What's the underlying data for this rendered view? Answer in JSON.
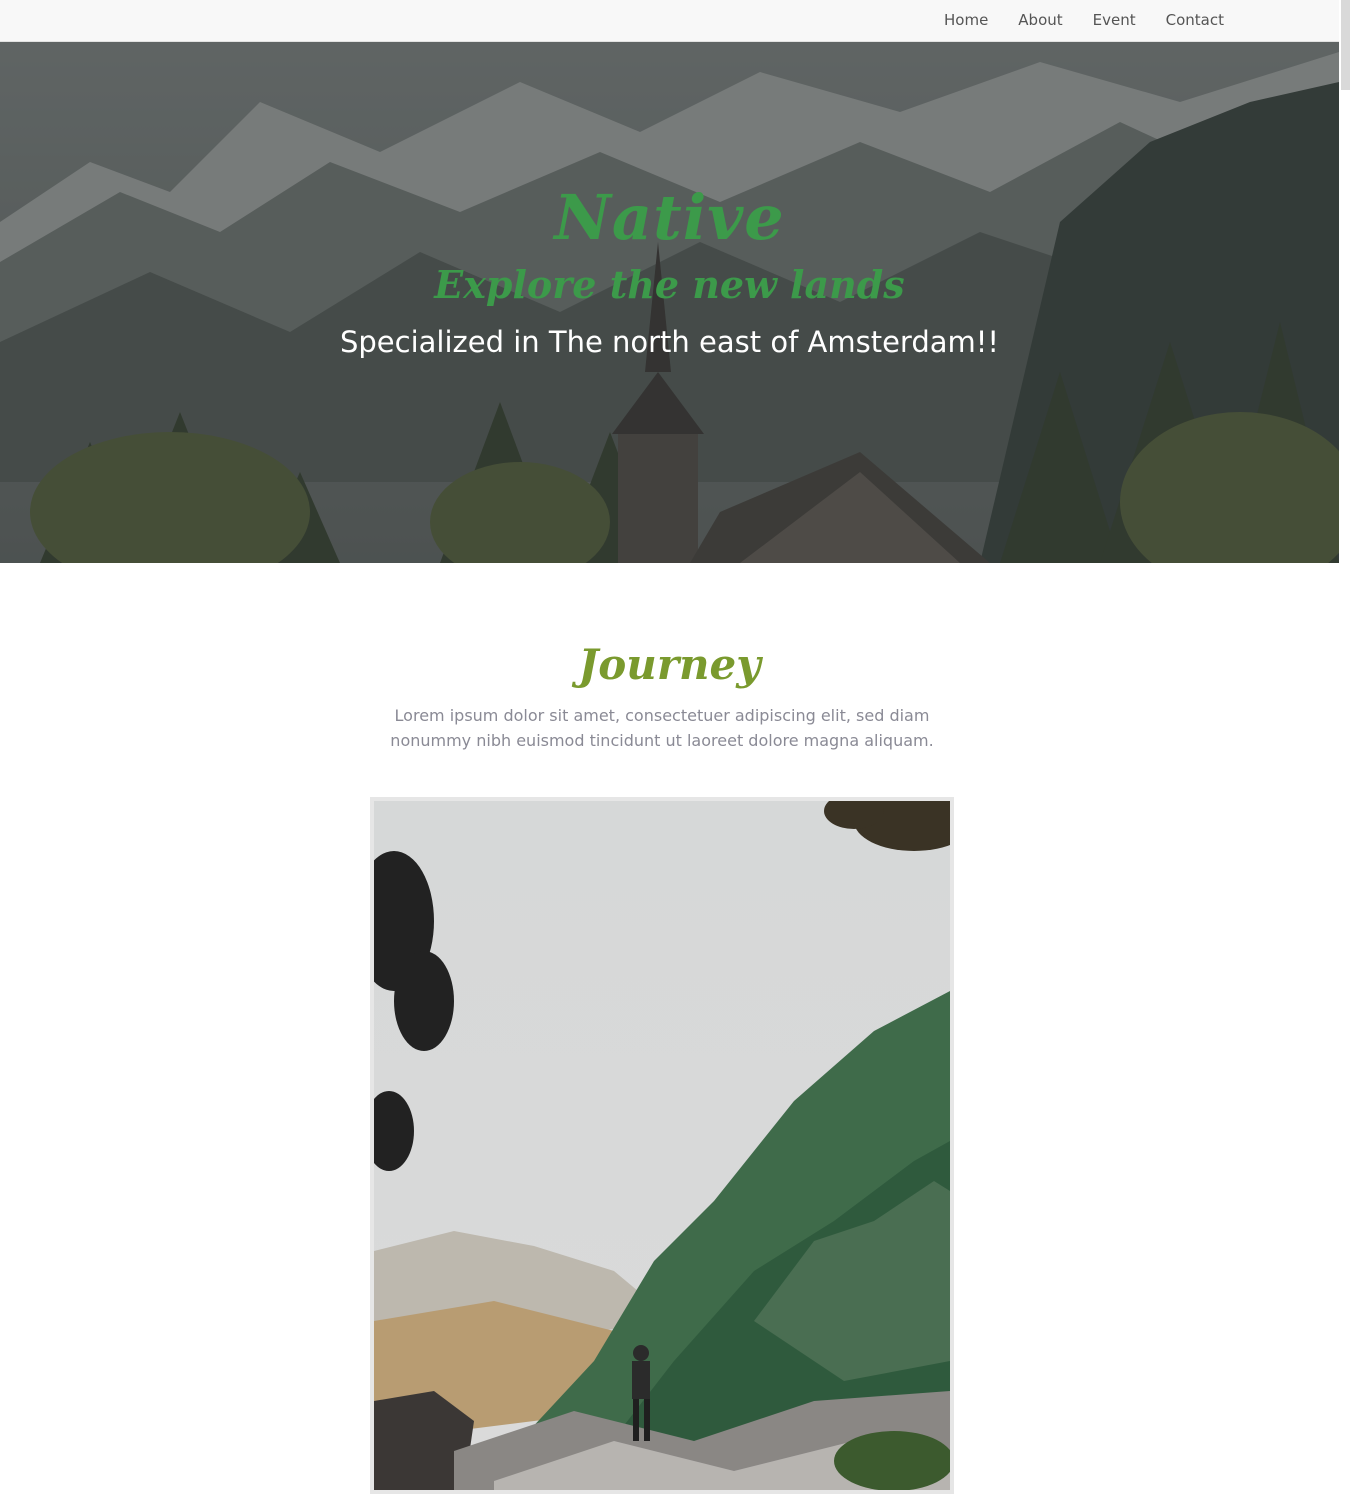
{
  "nav": {
    "items": [
      {
        "label": "Home"
      },
      {
        "label": "About"
      },
      {
        "label": "Event"
      },
      {
        "label": "Contact"
      }
    ]
  },
  "hero": {
    "title": "Native",
    "tagline": "Explore the new lands",
    "subtitle": "Specialized in The north east of Amsterdam!!"
  },
  "journey": {
    "title": "Journey",
    "text": "Lorem ipsum dolor sit amet, consectetuer adipiscing elit, sed diam nonummy nibh euismod tincidunt ut laoreet dolore magna aliquam."
  },
  "colors": {
    "accent_green": "#3c9a4a",
    "journey_green": "#7a9a2e",
    "nav_bg": "#f8f8f8",
    "body_text": "#8a8a95"
  }
}
